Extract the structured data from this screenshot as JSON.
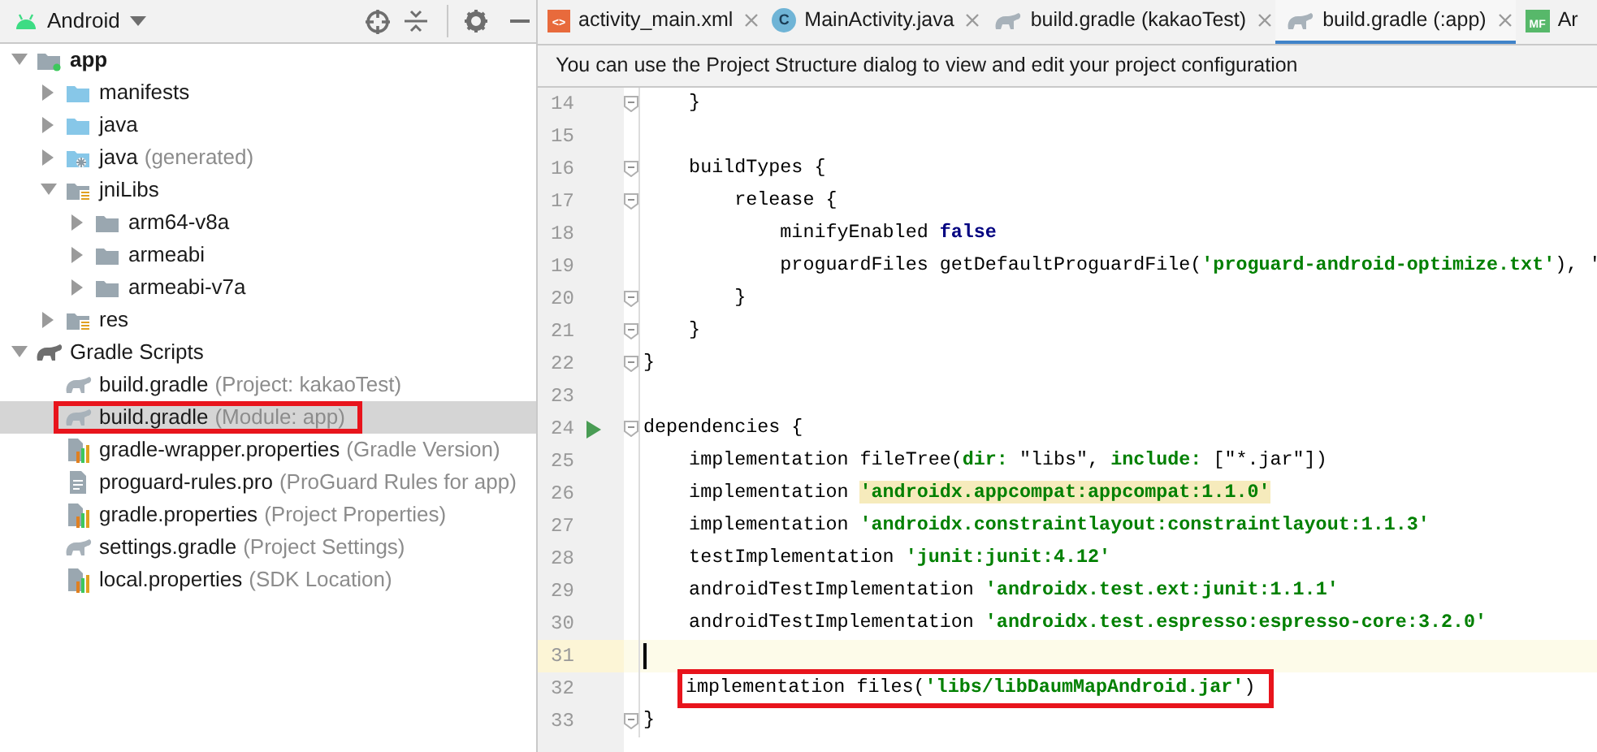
{
  "project_panel": {
    "view_selector": "Android",
    "tree": [
      {
        "label": "app",
        "kind": "module",
        "expanded": true,
        "bold": true,
        "children": [
          {
            "label": "manifests",
            "kind": "source-folder",
            "expanded": false
          },
          {
            "label": "java",
            "kind": "source-folder",
            "expanded": false
          },
          {
            "label": "java",
            "hint": "(generated)",
            "kind": "generated-folder",
            "expanded": false
          },
          {
            "label": "jniLibs",
            "kind": "resource-folder",
            "expanded": true,
            "children": [
              {
                "label": "arm64-v8a",
                "kind": "folder",
                "expanded": false
              },
              {
                "label": "armeabi",
                "kind": "folder",
                "expanded": false
              },
              {
                "label": "armeabi-v7a",
                "kind": "folder",
                "expanded": false
              }
            ]
          },
          {
            "label": "res",
            "kind": "resource-folder",
            "expanded": false
          }
        ]
      },
      {
        "label": "Gradle Scripts",
        "kind": "scripts",
        "expanded": true,
        "children": [
          {
            "label": "build.gradle",
            "hint": "(Project: kakaoTest)",
            "kind": "gradle",
            "selected": false,
            "callout": false
          },
          {
            "label": "build.gradle",
            "hint": "(Module: app)",
            "kind": "gradle",
            "selected": true,
            "callout": true
          },
          {
            "label": "gradle-wrapper.properties",
            "hint": "(Gradle Version)",
            "kind": "properties",
            "selected": false,
            "callout": false
          },
          {
            "label": "proguard-rules.pro",
            "hint": "(ProGuard Rules for app)",
            "kind": "text",
            "selected": false,
            "callout": false
          },
          {
            "label": "gradle.properties",
            "hint": "(Project Properties)",
            "kind": "properties",
            "selected": false,
            "callout": false
          },
          {
            "label": "settings.gradle",
            "hint": "(Project Settings)",
            "kind": "gradle",
            "selected": false,
            "callout": false
          },
          {
            "label": "local.properties",
            "hint": "(SDK Location)",
            "kind": "properties",
            "selected": false,
            "callout": false
          }
        ]
      }
    ]
  },
  "editor": {
    "tabs": [
      {
        "label": "activity_main.xml",
        "kind": "xml",
        "glyph": "<>",
        "selected": false,
        "closable": true
      },
      {
        "label": "MainActivity.java",
        "kind": "class",
        "glyph": "C",
        "selected": false,
        "closable": true
      },
      {
        "label": "build.gradle (kakaoTest)",
        "kind": "gradle",
        "selected": false,
        "closable": true
      },
      {
        "label": "build.gradle (:app)",
        "kind": "gradle",
        "selected": true,
        "closable": true
      },
      {
        "label": "Ar",
        "kind": "manifest",
        "glyph": "MF",
        "selected": false,
        "closable": false
      }
    ],
    "notification": "You can use the Project Structure dialog to view and edit your project configuration",
    "lines": [
      {
        "number": "14",
        "fold": true,
        "tokens": [
          {
            "kind": "plain",
            "text": "    }"
          }
        ]
      },
      {
        "number": "15"
      },
      {
        "number": "16",
        "fold": true,
        "tokens": [
          {
            "kind": "plain",
            "text": "    buildTypes {"
          }
        ]
      },
      {
        "number": "17",
        "fold": true,
        "tokens": [
          {
            "kind": "plain",
            "text": "        release {"
          }
        ]
      },
      {
        "number": "18",
        "tokens": [
          {
            "kind": "plain",
            "text": "            minifyEnabled "
          },
          {
            "kind": "keyword",
            "text": "false"
          }
        ]
      },
      {
        "number": "19",
        "tokens": [
          {
            "kind": "plain",
            "text": "            proguardFiles getDefaultProguardFile("
          },
          {
            "kind": "string",
            "text": "'proguard-android-optimize.txt'"
          },
          {
            "kind": "plain",
            "text": "), '"
          }
        ]
      },
      {
        "number": "20",
        "fold": true,
        "tokens": [
          {
            "kind": "plain",
            "text": "        }"
          }
        ]
      },
      {
        "number": "21",
        "fold": true,
        "tokens": [
          {
            "kind": "plain",
            "text": "    }"
          }
        ]
      },
      {
        "number": "22",
        "fold": true,
        "tokens": [
          {
            "kind": "plain",
            "text": "}"
          }
        ]
      },
      {
        "number": "23"
      },
      {
        "number": "24",
        "fold": true,
        "run": true,
        "tokens": [
          {
            "kind": "plain",
            "text": "dependencies {"
          }
        ]
      },
      {
        "number": "25",
        "tokens": [
          {
            "kind": "plain",
            "text": "    implementation fileTree("
          },
          {
            "kind": "param",
            "text": "dir: "
          },
          {
            "kind": "plain",
            "text": "\"libs\", "
          },
          {
            "kind": "param",
            "text": "include: "
          },
          {
            "kind": "plain",
            "text": "[\"*.jar\"])"
          }
        ]
      },
      {
        "number": "26",
        "tokens": [
          {
            "kind": "plain",
            "text": "    implementation "
          },
          {
            "kind": "match",
            "text": "'androidx.appcompat:appcompat:1.1.0'"
          }
        ]
      },
      {
        "number": "27",
        "tokens": [
          {
            "kind": "plain",
            "text": "    implementation "
          },
          {
            "kind": "string",
            "text": "'androidx.constraintlayout:constraintlayout:1.1.3'"
          }
        ]
      },
      {
        "number": "28",
        "tokens": [
          {
            "kind": "plain",
            "text": "    testImplementation "
          },
          {
            "kind": "string",
            "text": "'junit:junit:4.12'"
          }
        ]
      },
      {
        "number": "29",
        "tokens": [
          {
            "kind": "plain",
            "text": "    androidTestImplementation "
          },
          {
            "kind": "string",
            "text": "'androidx.test.ext:junit:1.1.1'"
          }
        ]
      },
      {
        "number": "30",
        "tokens": [
          {
            "kind": "plain",
            "text": "    androidTestImplementation "
          },
          {
            "kind": "string",
            "text": "'androidx.test.espresso:espresso-core:3.2.0'"
          }
        ]
      },
      {
        "number": "31",
        "current": true,
        "caret": true
      },
      {
        "number": "32",
        "callout": true,
        "tokens": [
          {
            "kind": "plain",
            "text": "implementation files("
          },
          {
            "kind": "string",
            "text": "'libs/libDaumMapAndroid.jar'"
          },
          {
            "kind": "plain",
            "text": ")"
          }
        ]
      },
      {
        "number": "33",
        "fold": true,
        "tokens": [
          {
            "kind": "plain",
            "text": "}"
          }
        ]
      }
    ]
  }
}
